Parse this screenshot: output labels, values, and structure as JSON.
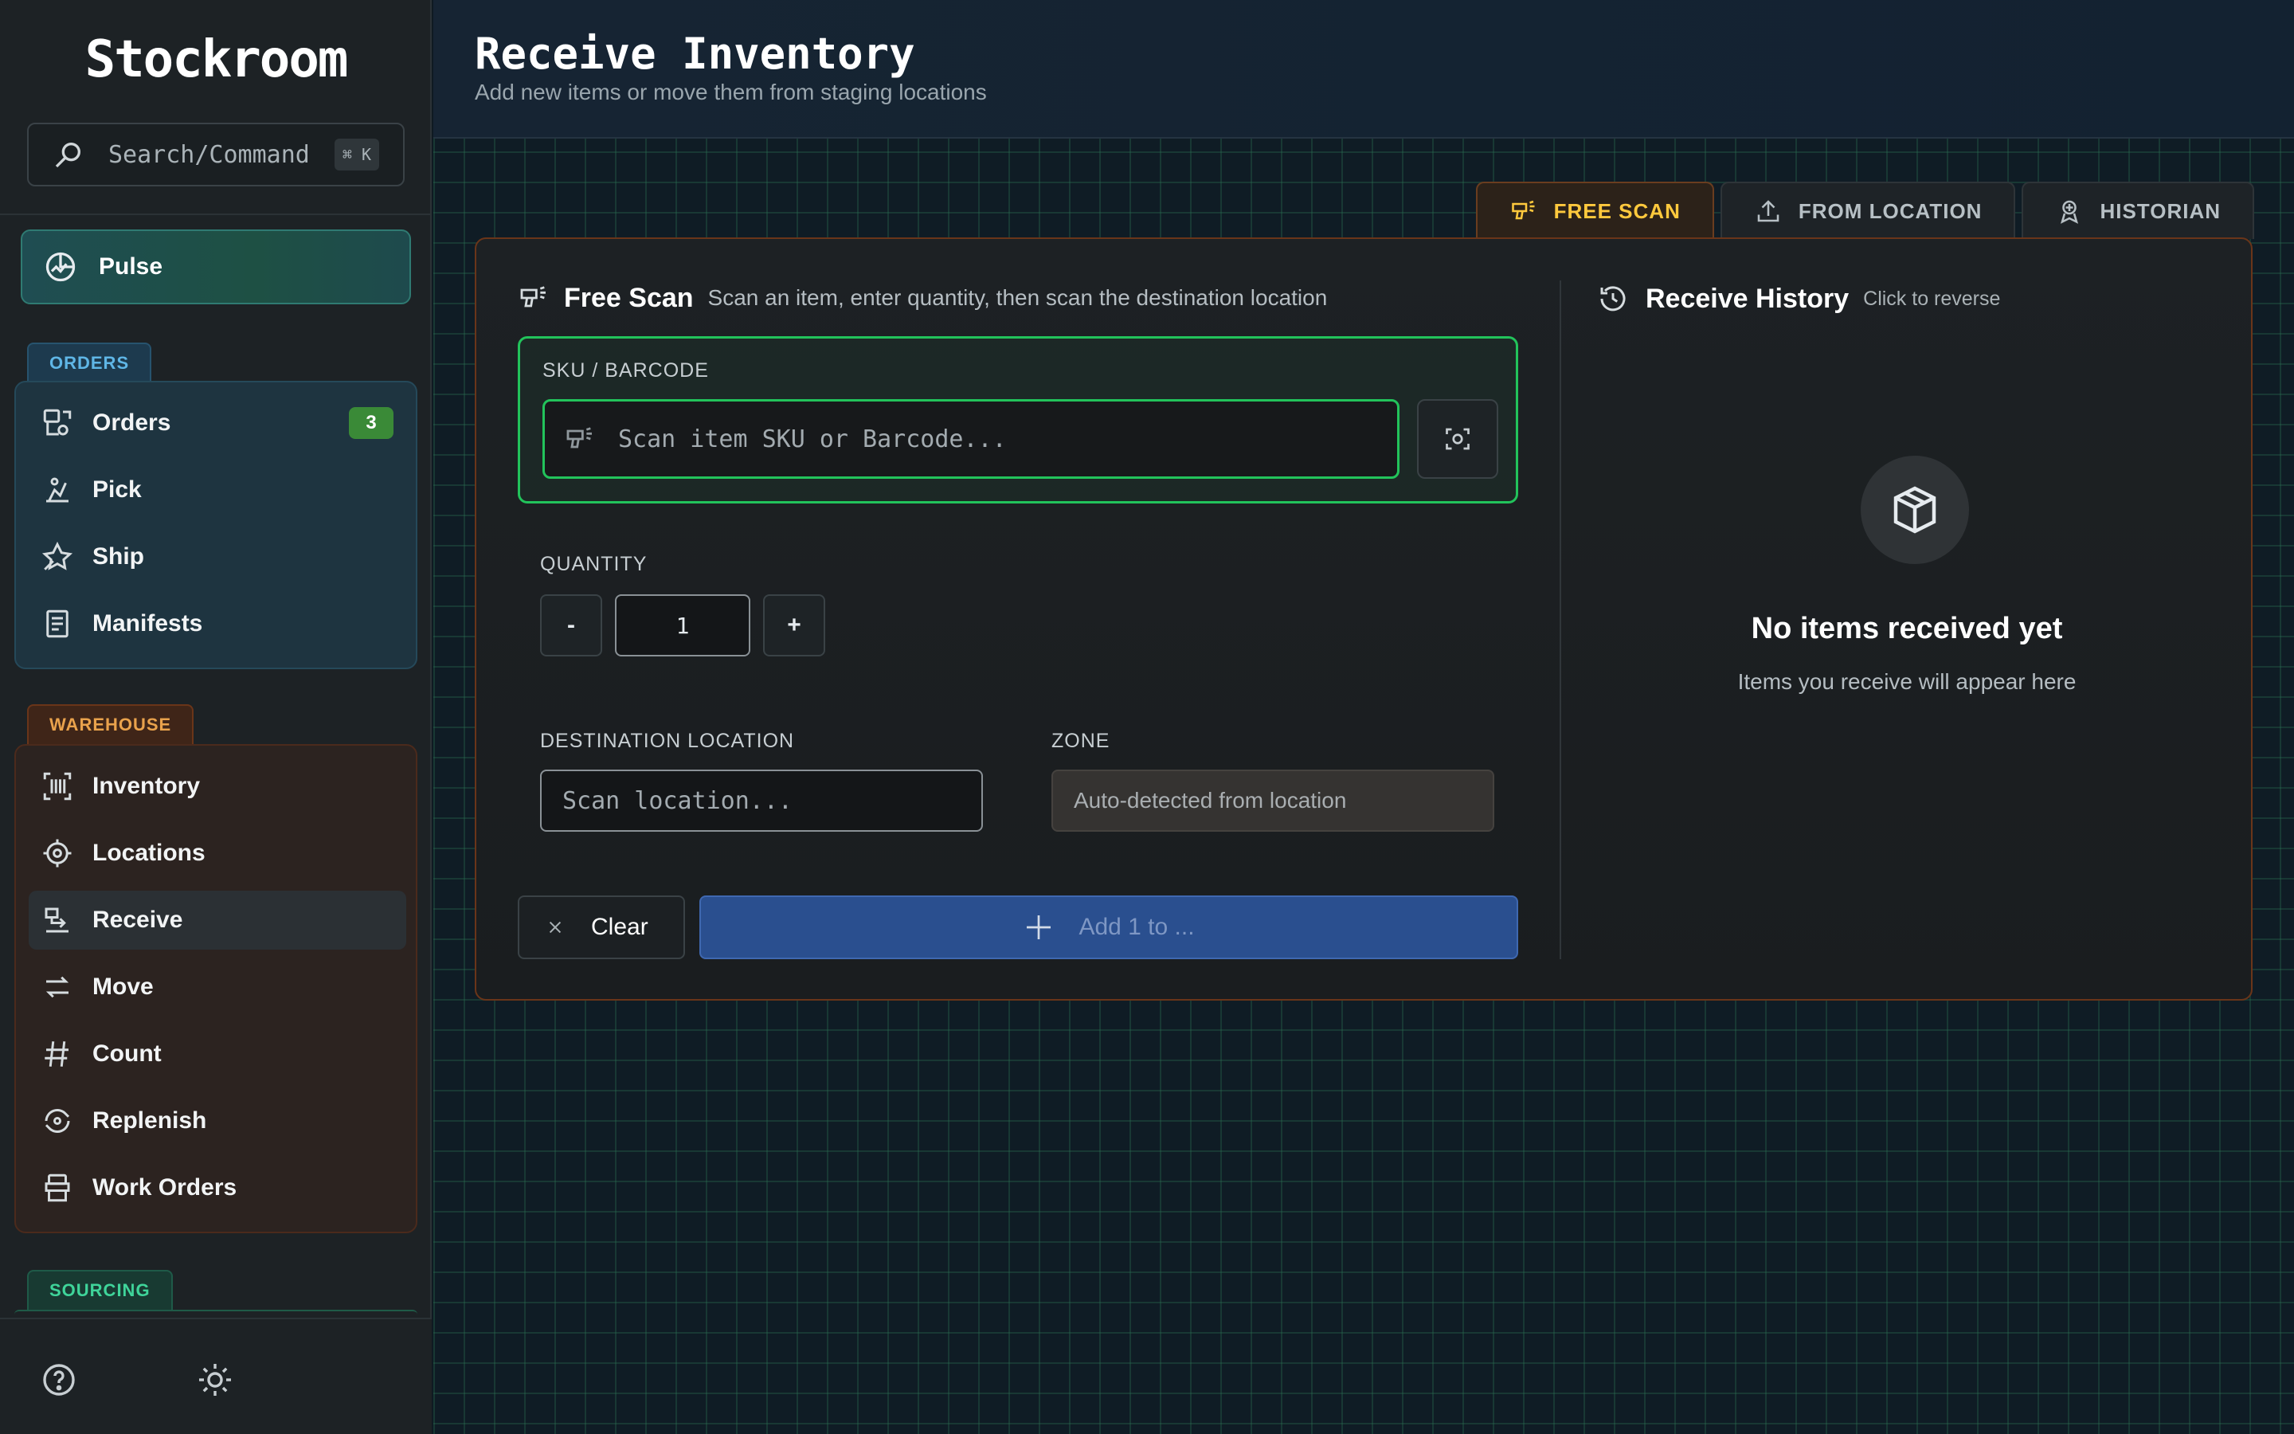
{
  "app": {
    "name": "Stockroom"
  },
  "search": {
    "placeholder": "Search/Command",
    "shortcut": "⌘ K"
  },
  "sidebar": {
    "pulse": {
      "label": "Pulse",
      "icon": "chart-pie-icon"
    },
    "sections": {
      "orders": {
        "title": "ORDERS",
        "items": [
          {
            "label": "Orders",
            "icon": "orders-icon",
            "badge": "3"
          },
          {
            "label": "Pick",
            "icon": "pick-icon"
          },
          {
            "label": "Ship",
            "icon": "ship-icon"
          },
          {
            "label": "Manifests",
            "icon": "manifest-icon"
          }
        ]
      },
      "warehouse": {
        "title": "WAREHOUSE",
        "items": [
          {
            "label": "Inventory",
            "icon": "barcode-icon"
          },
          {
            "label": "Locations",
            "icon": "target-icon"
          },
          {
            "label": "Receive",
            "icon": "receive-icon",
            "active": true
          },
          {
            "label": "Move",
            "icon": "move-icon"
          },
          {
            "label": "Count",
            "icon": "hash-icon"
          },
          {
            "label": "Replenish",
            "icon": "replenish-icon"
          },
          {
            "label": "Work Orders",
            "icon": "work-orders-icon"
          }
        ]
      },
      "sourcing": {
        "title": "SOURCING"
      }
    },
    "footer": {
      "help_icon": "help-icon",
      "theme_icon": "sun-icon"
    }
  },
  "page": {
    "title": "Receive Inventory",
    "subtitle": "Add new items or move them from staging locations"
  },
  "tabs": [
    {
      "label": "FREE SCAN",
      "icon": "scanner-icon",
      "active": true
    },
    {
      "label": "FROM LOCATION",
      "icon": "upload-icon"
    },
    {
      "label": "HISTORIAN",
      "icon": "historian-icon"
    }
  ],
  "free_scan": {
    "title": "Free Scan",
    "description": "Scan an item, enter quantity, then scan the destination location",
    "sku_label": "SKU / BARCODE",
    "sku_placeholder": "Scan item SKU or Barcode...",
    "quantity_label": "QUANTITY",
    "quantity_minus": "-",
    "quantity_value": "1",
    "quantity_plus": "+",
    "destination_label": "DESTINATION LOCATION",
    "destination_placeholder": "Scan location...",
    "zone_label": "ZONE",
    "zone_placeholder": "Auto-detected from location",
    "clear_label": "Clear",
    "add_label": "Add 1 to ..."
  },
  "history": {
    "title": "Receive History",
    "hint": "Click to reverse",
    "empty_title": "No items received yet",
    "empty_subtitle": "Items you receive will appear here"
  },
  "colors": {
    "accent_green": "#22c35b",
    "tab_active": "#ffc93d",
    "primary_blue": "#2a4f8f",
    "orders_accent": "#5fb6e6",
    "warehouse_accent": "#e9a24c",
    "sourcing_accent": "#3fd49a"
  }
}
